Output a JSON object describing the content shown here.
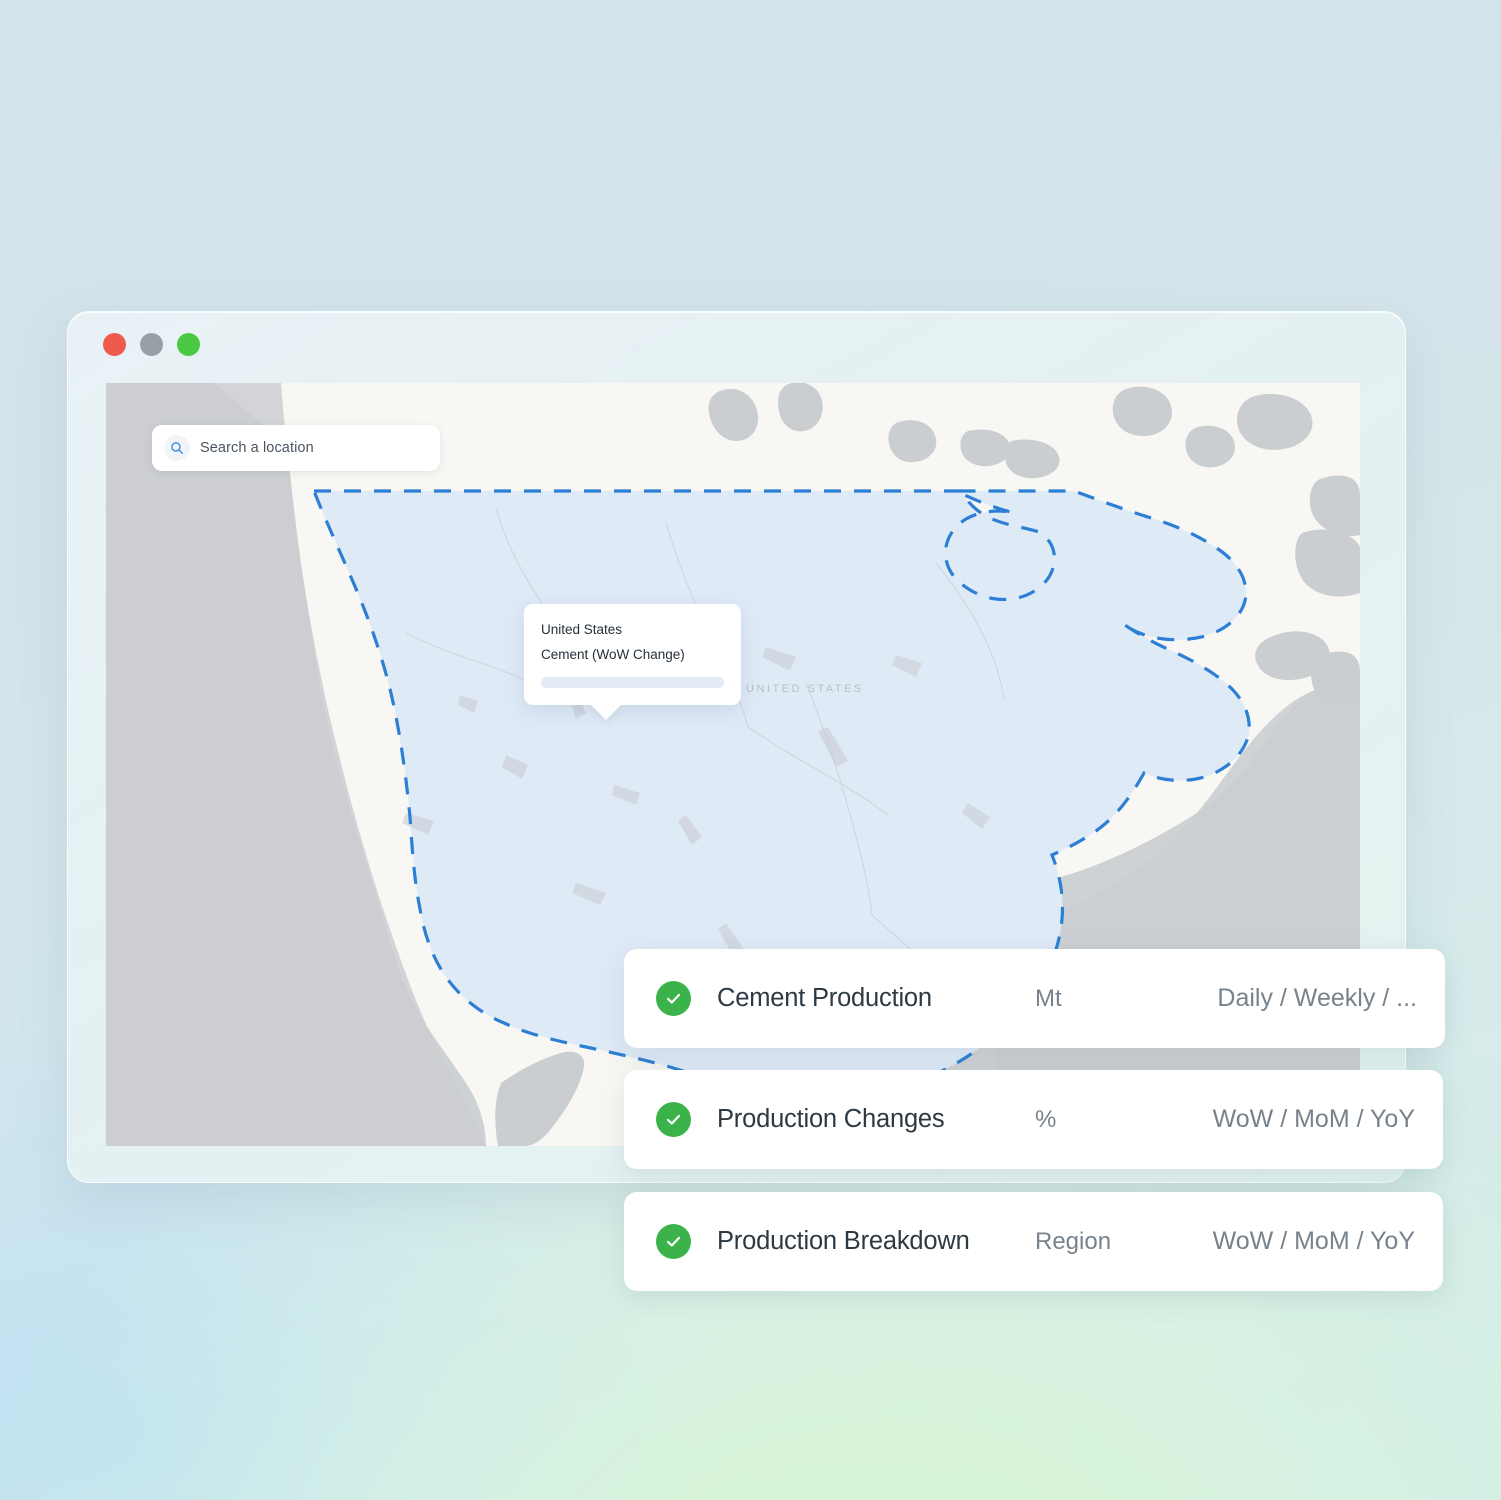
{
  "background": {
    "accent_blue": "#d3e3ea",
    "accent_green": "#daeee6"
  },
  "window": {
    "traffic_lights": [
      {
        "name": "close",
        "color": "#ef5a4c"
      },
      {
        "name": "minimize",
        "color": "#98a0a6"
      },
      {
        "name": "maximize",
        "color": "#4cc943"
      }
    ]
  },
  "map": {
    "search": {
      "placeholder": "Search a location",
      "icon": "search-icon"
    },
    "basemap_label": "UNITED STATES",
    "colors": {
      "ocean": "#cfd2d4",
      "land": "#f8f7f3",
      "land_shadow": "#cbced1",
      "selected_fill": "#dfeaf7",
      "selected_border": "#2b7fd4"
    },
    "tooltip": {
      "title": "United States",
      "subtitle": "Cement (WoW Change)",
      "value_placeholder": ""
    }
  },
  "cards": [
    {
      "icon": "check-circle-icon",
      "name": "Cement Production",
      "unit": "Mt",
      "period": "Daily / Weekly / ...",
      "enabled": true
    },
    {
      "icon": "check-circle-icon",
      "name": "Production Changes",
      "unit": "%",
      "period": "WoW / MoM / YoY",
      "enabled": true
    },
    {
      "icon": "check-circle-icon",
      "name": "Production Breakdown",
      "unit": "Region",
      "period": "WoW / MoM / YoY",
      "enabled": true
    }
  ]
}
